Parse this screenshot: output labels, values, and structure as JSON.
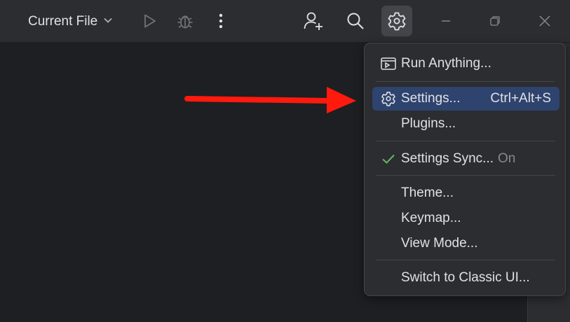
{
  "toolbar": {
    "run_config_label": "Current File",
    "icons": {
      "chevron": "chevron-down-icon",
      "run": "play-icon",
      "debug": "bug-icon",
      "more": "more-vertical-icon",
      "add_user": "add-user-icon",
      "search": "search-icon",
      "settings": "gear-icon",
      "minimize": "minimize-icon",
      "restore": "restore-icon",
      "close": "close-icon"
    }
  },
  "menu": {
    "run_anything": "Run Anything...",
    "settings": {
      "label": "Settings...",
      "shortcut": "Ctrl+Alt+S"
    },
    "plugins": "Plugins...",
    "settings_sync": {
      "label": "Settings Sync...",
      "state": "On"
    },
    "theme": "Theme...",
    "keymap": "Keymap...",
    "view_mode": "View Mode...",
    "switch_classic": "Switch to Classic UI..."
  },
  "colors": {
    "background": "#1e1f22",
    "toolbar": "#2b2d30",
    "highlight": "#2e436e",
    "check": "#5fb865",
    "annotation_arrow": "#ff1a0d"
  }
}
